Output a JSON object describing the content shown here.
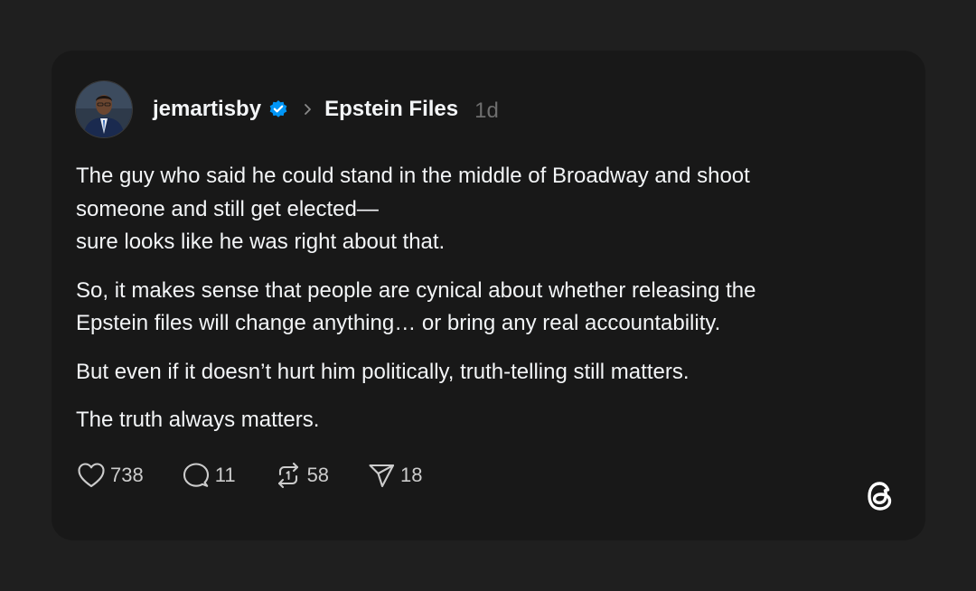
{
  "post": {
    "username": "jemartisby",
    "topic": "Epstein Files",
    "time": "1d",
    "paragraphs": [
      {
        "lines": [
          "The guy who said he could stand in the middle of Broadway and shoot",
          "someone and still get elected—",
          "sure looks like he was right about that."
        ]
      },
      {
        "lines": [
          "So, it makes sense that people are cynical about whether releasing the",
          "Epstein files will change anything… or bring any real accountability."
        ]
      },
      {
        "lines": [
          "But even if it doesn’t hurt him politically, truth-telling still matters."
        ]
      },
      {
        "lines": [
          "The truth always matters."
        ]
      }
    ],
    "actions": {
      "likes": "738",
      "replies": "11",
      "reposts": "58",
      "shares": "18"
    }
  },
  "icons": {
    "verified": "verified-badge-icon",
    "chevron": "chevron-right-icon",
    "like": "heart-icon",
    "reply": "comment-bubble-icon",
    "repost": "repost-icon",
    "share": "send-icon",
    "logo": "threads-logo-icon"
  },
  "colors": {
    "page_background": "#1f1f1f",
    "card_background": "#181818",
    "verified_blue": "#0095f6",
    "primary_text": "#f3f5f7",
    "muted_text": "#6e6e6e"
  }
}
